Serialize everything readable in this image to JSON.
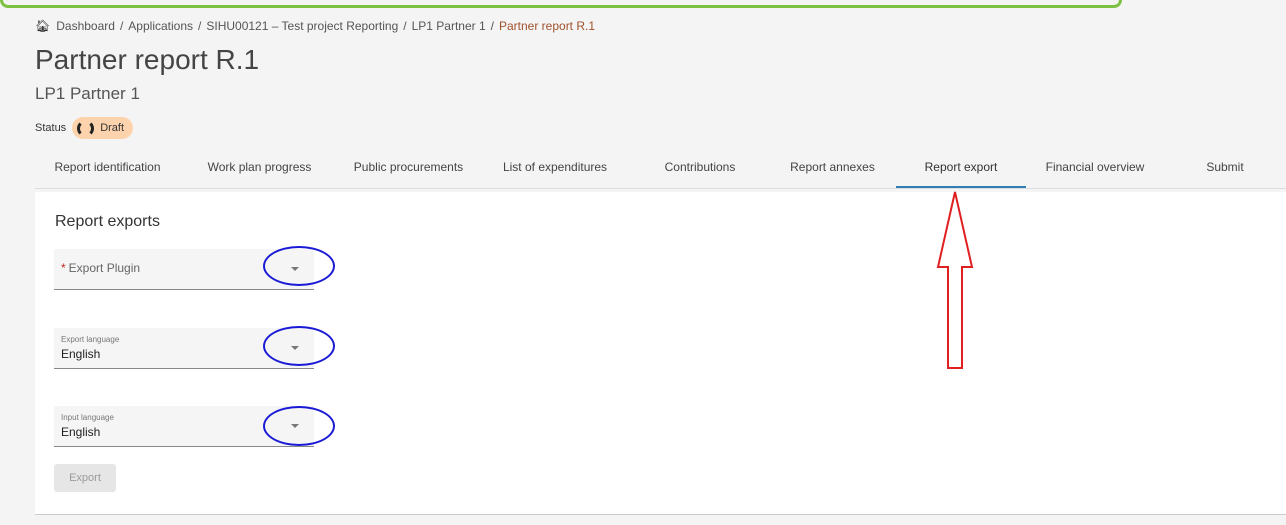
{
  "breadcrumb": {
    "items": [
      "Dashboard",
      "Applications",
      "SIHU00121 – Test project Reporting",
      "LP1 Partner 1"
    ],
    "current": "Partner report R.1",
    "separator": "/"
  },
  "page": {
    "title": "Partner report R.1",
    "subtitle": "LP1 Partner 1",
    "status_label": "Status",
    "status_value": "Draft"
  },
  "tabs": [
    {
      "label": "Report identification"
    },
    {
      "label": "Work plan progress"
    },
    {
      "label": "Public procurements"
    },
    {
      "label": "List of expenditures"
    },
    {
      "label": "Contributions"
    },
    {
      "label": "Report annexes"
    },
    {
      "label": "Report export",
      "active": true
    },
    {
      "label": "Financial overview"
    },
    {
      "label": "Submit"
    }
  ],
  "card": {
    "title": "Report exports",
    "export_plugin": {
      "required_mark": "*",
      "placeholder": "Export Plugin"
    },
    "export_language": {
      "label": "Export language",
      "value": "English"
    },
    "input_language": {
      "label": "Input language",
      "value": "English"
    },
    "export_button": "Export"
  },
  "colors": {
    "accent": "#2f7fb5",
    "status_badge": "#fcd3ac",
    "annotation_ring": "#1a1ad6",
    "annotation_arrow": "#e02020",
    "top_border": "#7cc142"
  },
  "icons": [
    "home-icon",
    "draft-status-icon",
    "dropdown-arrow-icon"
  ]
}
